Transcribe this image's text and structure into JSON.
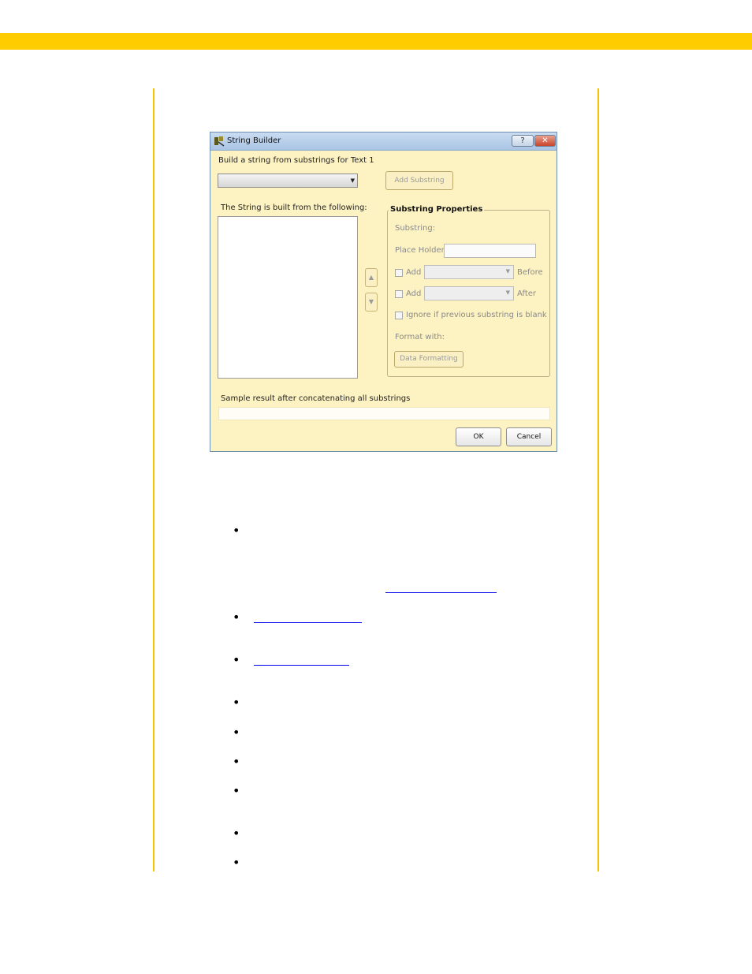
{
  "dialog": {
    "title": "String Builder",
    "help_label": "?",
    "close_label": "✕",
    "build_label": "Build a string from substrings for Text 1",
    "add_substring_label": "Add Substring",
    "list_label": "The String is built from the following:",
    "move_up_label": "▲",
    "move_down_label": "▼",
    "properties": {
      "title": "Substring Properties",
      "substring_label": "Substring:",
      "placeholder_label": "Place Holder:",
      "add_label": "Add",
      "before_label": "Before",
      "after_label": "After",
      "ignore_label": "Ignore if previous substring is blank",
      "format_label": "Format with:",
      "data_formatting_label": "Data Formatting"
    },
    "sample_label": "Sample result after concatenating all substrings",
    "ok_label": "OK",
    "cancel_label": "Cancel"
  },
  "colors": {
    "accent_bar": "#ffcc00",
    "dialog_bg": "#fdf2c1",
    "link": "#0000ee"
  },
  "icons": {
    "app": "string-builder-app-icon",
    "dropdown": "chevron-down-icon",
    "up": "arrow-up-icon",
    "down": "arrow-down-icon"
  },
  "bullets": [
    "•",
    "•",
    "•",
    "•",
    "•",
    "•",
    "•",
    "•",
    "•"
  ]
}
